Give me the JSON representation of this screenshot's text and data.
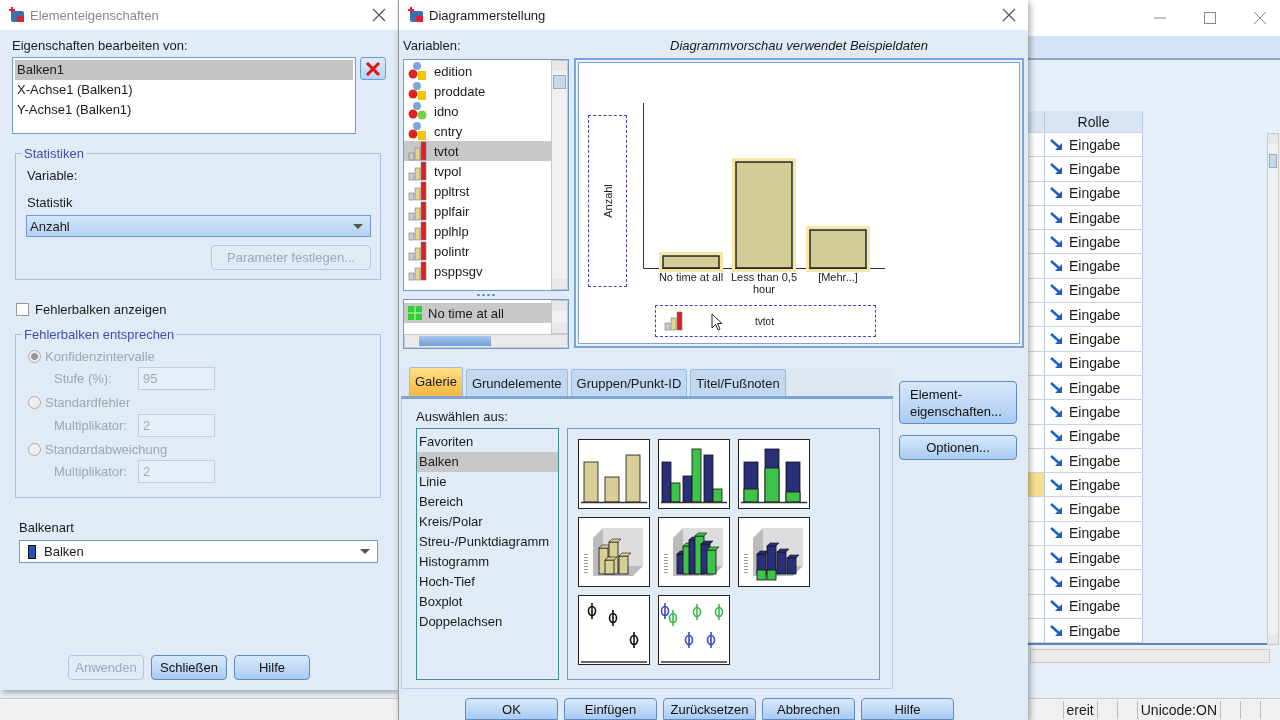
{
  "element_properties": {
    "title": "Elementeigenschaften",
    "edit_label": "Eigenschaften bearbeiten von:",
    "edit_items": [
      {
        "label": "Balken1",
        "selected": true
      },
      {
        "label": "X-Achse1 (Balken1)",
        "selected": false
      },
      {
        "label": "Y-Achse1 (Balken1)",
        "selected": false
      }
    ],
    "statistics": {
      "legend": "Statistiken",
      "variable_label": "Variable:",
      "statistic_label": "Statistik",
      "statistic_value": "Anzahl",
      "parameter_button": {
        "label": "Parameter festlegen...",
        "disabled": true
      }
    },
    "error_bars_checkbox": {
      "label": "Fehlerbalken anzeigen",
      "checked": false
    },
    "error_bars_group": {
      "legend": "Fehlerbalken entsprechen",
      "options": [
        {
          "label": "Konfidenzintervalle",
          "selected": true,
          "disabled": true,
          "field_label": "Stufe (%):",
          "field_value": "95"
        },
        {
          "label": "Standardfehler",
          "selected": false,
          "disabled": true,
          "field_label": "Multiplikator:",
          "field_value": "2"
        },
        {
          "label": "Standardabweichung",
          "selected": false,
          "disabled": true,
          "field_label": "Multiplikator:",
          "field_value": "2"
        }
      ]
    },
    "bar_type": {
      "label": "Balkenart",
      "value": "Balken"
    },
    "buttons": [
      {
        "label": "Anwenden",
        "disabled": true
      },
      {
        "label": "Schließen",
        "disabled": false
      },
      {
        "label": "Hilfe",
        "disabled": false
      }
    ]
  },
  "chart_builder": {
    "title": "Diagrammerstellung",
    "variables_label": "Variablen:",
    "variables": [
      {
        "name": "edition",
        "kind": "string",
        "selected": false
      },
      {
        "name": "proddate",
        "kind": "string",
        "selected": false
      },
      {
        "name": "idno",
        "kind": "nominal",
        "selected": false
      },
      {
        "name": "cntry",
        "kind": "string",
        "selected": false
      },
      {
        "name": "tvtot",
        "kind": "ordinal",
        "selected": true
      },
      {
        "name": "tvpol",
        "kind": "ordinal",
        "selected": false
      },
      {
        "name": "ppltrst",
        "kind": "ordinal",
        "selected": false
      },
      {
        "name": "pplfair",
        "kind": "ordinal",
        "selected": false
      },
      {
        "name": "pplhlp",
        "kind": "ordinal",
        "selected": false
      },
      {
        "name": "polintr",
        "kind": "ordinal",
        "selected": false
      },
      {
        "name": "psppsgv",
        "kind": "ordinal",
        "selected": false
      }
    ],
    "categories": [
      {
        "label": "No time at all",
        "selected": true
      }
    ],
    "preview_caption": "Diagrammvorschau verwendet Beispieldaten",
    "preview": {
      "y_axis_label": "Anzahl",
      "x_axis_variable": "tvtot",
      "bars": [
        {
          "label": "No time at all"
        },
        {
          "label": "Less than 0,5 hour"
        },
        {
          "label": "[Mehr...]"
        }
      ]
    },
    "tabs": [
      {
        "label": "Galerie",
        "selected": true
      },
      {
        "label": "Grundelemente",
        "selected": false
      },
      {
        "label": "Gruppen/Punkt-ID",
        "selected": false
      },
      {
        "label": "Titel/Fußnoten",
        "selected": false
      }
    ],
    "select_from_label": "Auswählen aus:",
    "chart_types": [
      {
        "label": "Favoriten",
        "selected": false
      },
      {
        "label": "Balken",
        "selected": true
      },
      {
        "label": "Linie",
        "selected": false
      },
      {
        "label": "Bereich",
        "selected": false
      },
      {
        "label": "Kreis/Polar",
        "selected": false
      },
      {
        "label": "Streu-/Punktdiagramm",
        "selected": false
      },
      {
        "label": "Histogramm",
        "selected": false
      },
      {
        "label": "Hoch-Tief",
        "selected": false
      },
      {
        "label": "Boxplot",
        "selected": false
      },
      {
        "label": "Doppelachsen",
        "selected": false
      }
    ],
    "gallery": [
      {
        "kind": "simple"
      },
      {
        "kind": "clustered"
      },
      {
        "kind": "stacked"
      },
      {
        "kind": "simple3d"
      },
      {
        "kind": "clustered3d"
      },
      {
        "kind": "stacked3d"
      },
      {
        "kind": "errorbar"
      },
      {
        "kind": "clustered_errorbar"
      }
    ],
    "side_buttons": [
      "Element-\neigenschaften...",
      "Optionen..."
    ],
    "bottom_buttons": [
      "OK",
      "Einfügen",
      "Zurücksetzen",
      "Abbrechen",
      "Hilfe"
    ]
  },
  "data_editor": {
    "column_header": "Rolle",
    "rows": [
      {
        "role": "Eingabe",
        "highlighted": false
      },
      {
        "role": "Eingabe",
        "highlighted": false
      },
      {
        "role": "Eingabe",
        "highlighted": false
      },
      {
        "role": "Eingabe",
        "highlighted": false
      },
      {
        "role": "Eingabe",
        "highlighted": false
      },
      {
        "role": "Eingabe",
        "highlighted": false
      },
      {
        "role": "Eingabe",
        "highlighted": false
      },
      {
        "role": "Eingabe",
        "highlighted": false
      },
      {
        "role": "Eingabe",
        "highlighted": false
      },
      {
        "role": "Eingabe",
        "highlighted": false
      },
      {
        "role": "Eingabe",
        "highlighted": false
      },
      {
        "role": "Eingabe",
        "highlighted": false
      },
      {
        "role": "Eingabe",
        "highlighted": false
      },
      {
        "role": "Eingabe",
        "highlighted": false
      },
      {
        "role": "Eingabe",
        "highlighted": true
      },
      {
        "role": "Eingabe",
        "highlighted": false
      },
      {
        "role": "Eingabe",
        "highlighted": false
      },
      {
        "role": "Eingabe",
        "highlighted": false
      },
      {
        "role": "Eingabe",
        "highlighted": false
      },
      {
        "role": "Eingabe",
        "highlighted": false
      },
      {
        "role": "Eingabe",
        "highlighted": false
      }
    ],
    "status_bar": [
      "ereit",
      "Unicode:ON"
    ]
  }
}
